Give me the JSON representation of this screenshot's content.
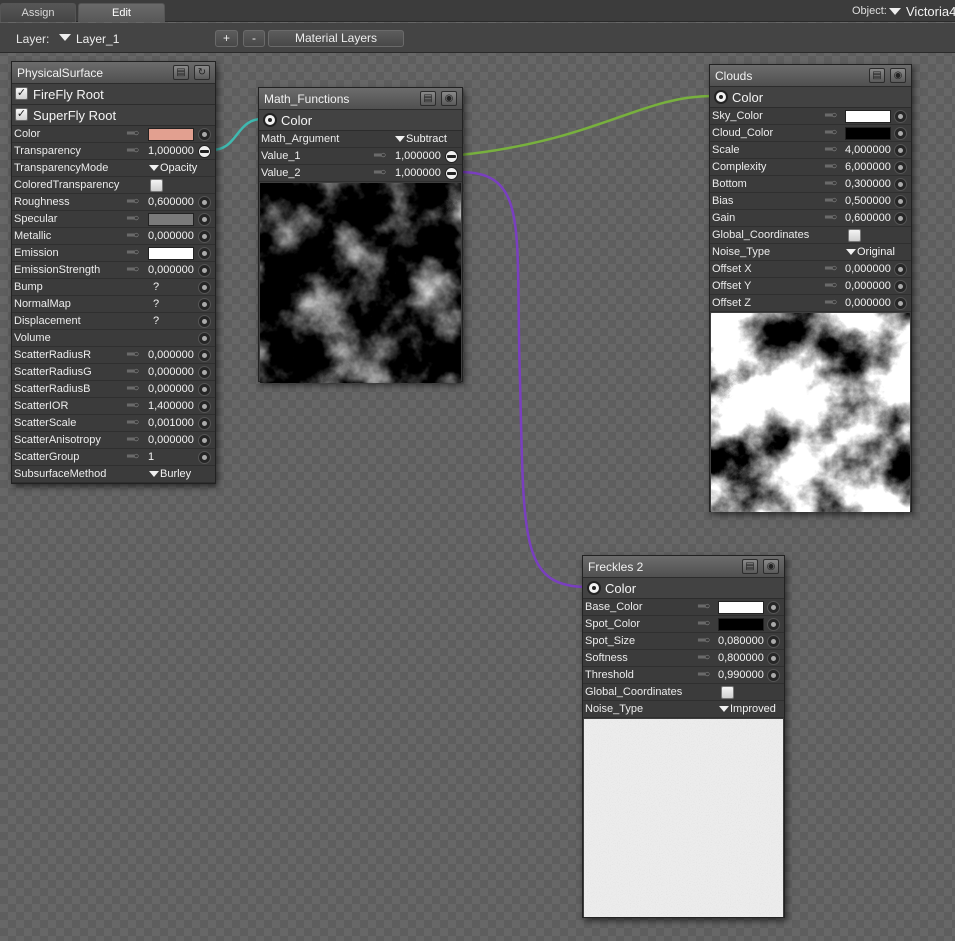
{
  "tabs": [
    {
      "label": "Assign",
      "active": false
    },
    {
      "label": "Edit",
      "active": true
    }
  ],
  "object": {
    "label": "Object:",
    "value": "Victoria4"
  },
  "toolbar": {
    "layer_label": "Layer:",
    "layer_value": "Layer_1",
    "add_label": "+",
    "remove_label": "-",
    "material_layers_label": "Material Layers"
  },
  "colors": {
    "wire_transparency": "#3fb9b0",
    "wire_value1": "#78b13d",
    "wire_value2": "#7a3fc0",
    "color_swatch": "#e2a090",
    "specular_swatch": "#7a7a7a"
  },
  "physical_surface": {
    "title": "PhysicalSurface",
    "roots": [
      "FireFly Root",
      "SuperFly Root"
    ],
    "rows": [
      {
        "label": "Color",
        "type": "swatch",
        "color": "#e2a090"
      },
      {
        "label": "Transparency",
        "type": "value",
        "value": "1,000000",
        "connected": true
      },
      {
        "label": "TransparencyMode",
        "type": "dropdown",
        "value": "Opacity"
      },
      {
        "label": "ColoredTransparency",
        "type": "checkbox"
      },
      {
        "label": "Roughness",
        "type": "value",
        "value": "0,600000"
      },
      {
        "label": "Specular",
        "type": "swatch",
        "color": "#7a7a7a"
      },
      {
        "label": "Metallic",
        "type": "value",
        "value": "0,000000"
      },
      {
        "label": "Emission",
        "type": "swatch",
        "color": "#ffffff"
      },
      {
        "label": "EmissionStrength",
        "type": "value",
        "value": "0,000000"
      },
      {
        "label": "Bump",
        "type": "text",
        "value": "?"
      },
      {
        "label": "NormalMap",
        "type": "text",
        "value": "?"
      },
      {
        "label": "Displacement",
        "type": "text",
        "value": "?"
      },
      {
        "label": "Volume",
        "type": "socket"
      },
      {
        "label": "ScatterRadiusR",
        "type": "value",
        "value": "0,000000"
      },
      {
        "label": "ScatterRadiusG",
        "type": "value",
        "value": "0,000000"
      },
      {
        "label": "ScatterRadiusB",
        "type": "value",
        "value": "0,000000"
      },
      {
        "label": "ScatterIOR",
        "type": "value",
        "value": "1,400000"
      },
      {
        "label": "ScatterScale",
        "type": "value",
        "value": "0,001000"
      },
      {
        "label": "ScatterAnisotropy",
        "type": "value",
        "value": "0,000000"
      },
      {
        "label": "ScatterGroup",
        "type": "value",
        "value": "1"
      },
      {
        "label": "SubsurfaceMethod",
        "type": "dropdown",
        "value": "Burley"
      }
    ]
  },
  "math_functions": {
    "title": "Math_Functions",
    "output": "Color",
    "rows": [
      {
        "label": "Math_Argument",
        "type": "dropdown",
        "value": "Subtract"
      },
      {
        "label": "Value_1",
        "type": "value",
        "value": "1,000000",
        "connected": true
      },
      {
        "label": "Value_2",
        "type": "value",
        "value": "1,000000",
        "connected": true
      }
    ]
  },
  "clouds": {
    "title": "Clouds",
    "output": "Color",
    "rows": [
      {
        "label": "Sky_Color",
        "type": "swatch",
        "color": "#ffffff"
      },
      {
        "label": "Cloud_Color",
        "type": "swatch",
        "color": "#000000"
      },
      {
        "label": "Scale",
        "type": "value",
        "value": "4,000000"
      },
      {
        "label": "Complexity",
        "type": "value",
        "value": "6,000000"
      },
      {
        "label": "Bottom",
        "type": "value",
        "value": "0,300000"
      },
      {
        "label": "Bias",
        "type": "value",
        "value": "0,500000"
      },
      {
        "label": "Gain",
        "type": "value",
        "value": "0,600000"
      },
      {
        "label": "Global_Coordinates",
        "type": "checkbox"
      },
      {
        "label": "Noise_Type",
        "type": "dropdown",
        "value": "Original"
      },
      {
        "label": "Offset X",
        "type": "value",
        "value": "0,000000"
      },
      {
        "label": "Offset Y",
        "type": "value",
        "value": "0,000000"
      },
      {
        "label": "Offset Z",
        "type": "value",
        "value": "0,000000"
      }
    ]
  },
  "freckles": {
    "title": "Freckles 2",
    "output": "Color",
    "rows": [
      {
        "label": "Base_Color",
        "type": "swatch",
        "color": "#ffffff"
      },
      {
        "label": "Spot_Color",
        "type": "swatch",
        "color": "#000000"
      },
      {
        "label": "Spot_Size",
        "type": "value",
        "value": "0,080000"
      },
      {
        "label": "Softness",
        "type": "value",
        "value": "0,800000"
      },
      {
        "label": "Threshold",
        "type": "value",
        "value": "0,990000"
      },
      {
        "label": "Global_Coordinates",
        "type": "checkbox"
      },
      {
        "label": "Noise_Type",
        "type": "dropdown",
        "value": "Improved"
      }
    ]
  }
}
